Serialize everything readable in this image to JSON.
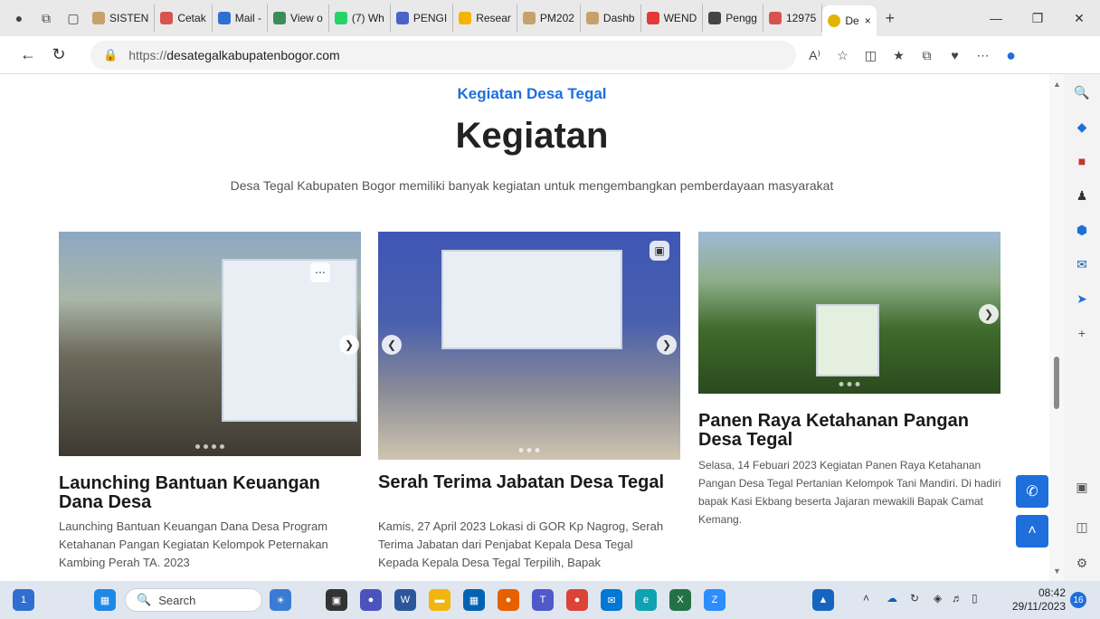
{
  "browser": {
    "tabs": [
      {
        "label": "SISTEN",
        "color": "#c6a16a"
      },
      {
        "label": "Cetak",
        "color": "#d8534f"
      },
      {
        "label": "Mail -",
        "color": "#2f6fd0"
      },
      {
        "label": "View o",
        "color": "#3a8d5a"
      },
      {
        "label": "(7) Wh",
        "color": "#25d366"
      },
      {
        "label": "PENGI",
        "color": "#4a63c9"
      },
      {
        "label": "Resear",
        "color": "#f4b400"
      },
      {
        "label": "PM202",
        "color": "#c6a16a"
      },
      {
        "label": "Dashb",
        "color": "#c6a16a"
      },
      {
        "label": "WEND",
        "color": "#e53935"
      },
      {
        "label": "Pengg",
        "color": "#444444"
      },
      {
        "label": "12975",
        "color": "#d8534f"
      }
    ],
    "active_tab": {
      "label": "De",
      "close": "×",
      "color": "#e0b400"
    },
    "new_tab": "+",
    "url_host": "desategalkabupatenbogor.com",
    "url_scheme": "https://",
    "read_aloud": "A⁾"
  },
  "page": {
    "eyebrow": "Kegiatan Desa Tegal",
    "headline": "Kegiatan",
    "subtitle": "Desa Tegal Kabupaten Bogor memiliki banyak kegiatan untuk mengembangkan pemberdayaan masyarakat",
    "cards": [
      {
        "title": "Launching Bantuan Keuangan Dana Desa",
        "text": "Launching Bantuan Keuangan Dana Desa Program Ketahanan Pangan Kegiatan Kelompok Peternakan Kambing Perah TA. 2023"
      },
      {
        "title": "Serah Terima Jabatan Desa Tegal",
        "text": "Kamis, 27 April 2023 Lokasi di GOR Kp Nagrog, Serah Terima Jabatan dari Penjabat Kepala Desa Tegal Kepada Kepala Desa Tegal Terpilih, Bapak"
      },
      {
        "title": "Panen Raya Ketahanan Pangan Desa Tegal",
        "text": "Selasa, 14 Febuari 2023 Kegiatan Panen Raya Ketahanan Pangan Desa Tegal Pertanian Kelompok Tani Mandiri. Di hadiri bapak Kasi Ekbang beserta Jajaran mewakili Bapak Camat Kemang."
      }
    ]
  },
  "taskbar": {
    "search_label": "Search",
    "time": "08:42",
    "date": "29/11/2023",
    "notification_count": "16",
    "alert_badge": "1"
  }
}
